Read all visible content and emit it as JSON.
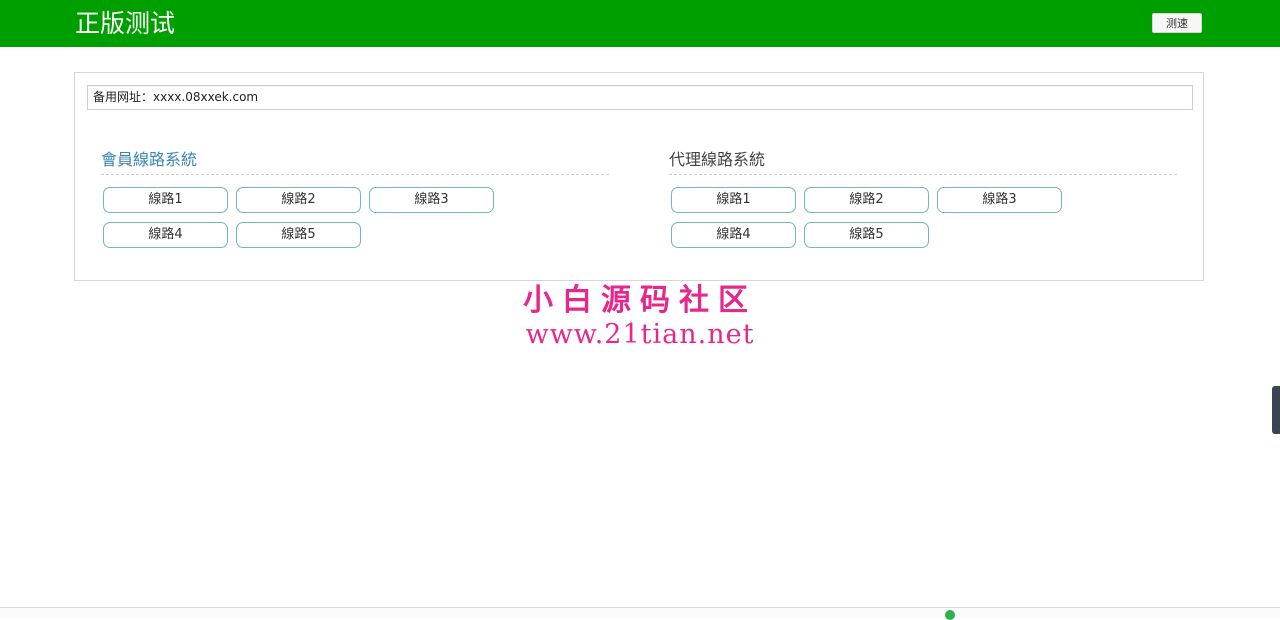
{
  "header": {
    "title": "正版测试",
    "speed_test_label": "测速"
  },
  "panel": {
    "backup_url": "备用网址：xxxx.08xxek.com",
    "member": {
      "title": "會員線路系統",
      "title_color": "#3a86b4",
      "lines": [
        "線路1",
        "線路2",
        "線路3",
        "線路4",
        "線路5"
      ]
    },
    "agent": {
      "title": "代理線路系統",
      "title_color": "#444444",
      "lines": [
        "線路1",
        "線路2",
        "線路3",
        "線路4",
        "線路5"
      ]
    }
  },
  "watermark": {
    "chinese": "小白源码社区",
    "url": "www.21tian.net"
  },
  "colors": {
    "header_bg": "#009f00",
    "watermark": "#e6288c",
    "button_border": "#6fb6c8"
  }
}
